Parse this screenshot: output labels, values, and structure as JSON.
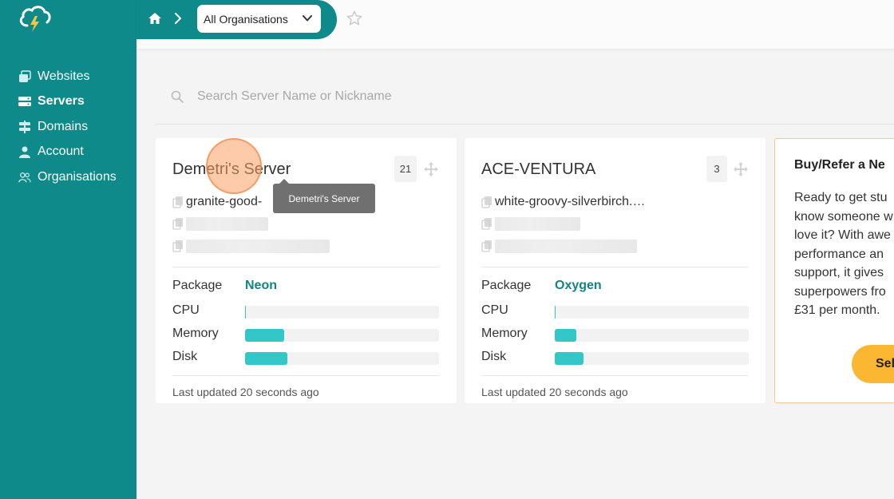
{
  "colors": {
    "brand": "#0e8a8a",
    "accent_bar": "#33c7c7",
    "package_text": "#128484",
    "promo_button": "#fbb731",
    "promo_border": "#f5c78e"
  },
  "breadcrumb": {
    "org_selector": "All Organisations"
  },
  "sidebar": {
    "items": [
      {
        "label": "Websites",
        "icon": "websites-icon"
      },
      {
        "label": "Servers",
        "icon": "servers-icon"
      },
      {
        "label": "Domains",
        "icon": "domains-icon"
      },
      {
        "label": "Account",
        "icon": "account-icon"
      },
      {
        "label": "Organisations",
        "icon": "organisations-icon"
      }
    ],
    "active": "Servers"
  },
  "search": {
    "placeholder": "Search Server Name or Nickname"
  },
  "labels": {
    "package": "Package",
    "cpu": "CPU",
    "memory": "Memory",
    "disk": "Disk"
  },
  "servers": [
    {
      "name": "Demetri's Server",
      "count": "21",
      "hostname": "granite-good-",
      "package": "Neon",
      "usage": {
        "cpu": 0.005,
        "memory": 0.2,
        "disk": 0.22
      },
      "updated": "Last updated 20 seconds ago"
    },
    {
      "name": "ACE-VENTURA",
      "count": "3",
      "hostname": "white-groovy-silverbirch.…",
      "package": "Oxygen",
      "usage": {
        "cpu": 0.005,
        "memory": 0.11,
        "disk": 0.15
      },
      "updated": "Last updated 20 seconds ago"
    }
  ],
  "promo": {
    "title": "Buy/Refer a Ne",
    "lines": [
      "Ready to get stu",
      "know someone w",
      "love it? With awe",
      "performance an",
      "support, it gives",
      "superpowers fro",
      "£31 per month."
    ],
    "button": "Sel"
  },
  "tooltip": {
    "text": "Demetri's Server"
  }
}
